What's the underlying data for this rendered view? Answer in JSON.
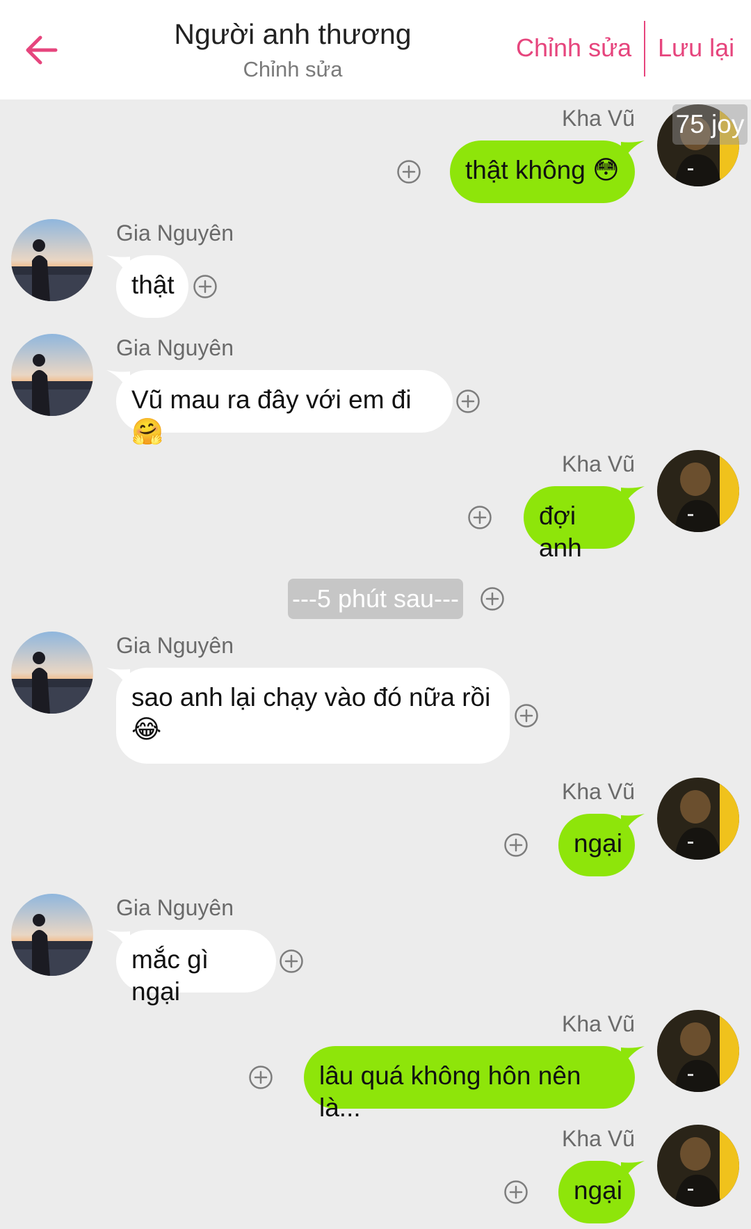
{
  "header": {
    "title": "Người anh thương",
    "subtitle": "Chỉnh sửa",
    "edit_label": "Chỉnh sửa",
    "save_label": "Lưu lại",
    "accent": "#e6457d"
  },
  "joy_badge": "75 joy",
  "colors": {
    "sent_bubble": "#8ee50a",
    "received_bubble": "#ffffff",
    "background": "#ececec"
  },
  "messages": [
    {
      "side": "right",
      "name": "Kha Vũ",
      "text": "thật không 😳"
    },
    {
      "side": "left",
      "name": "Gia Nguyên",
      "text": "thật"
    },
    {
      "side": "left",
      "name": "Gia Nguyên",
      "text": "Vũ mau ra đây với em đi 🤗"
    },
    {
      "side": "right",
      "name": "Kha Vũ",
      "text": "đợi anh"
    },
    {
      "side": "separator",
      "text": "---5 phút sau---"
    },
    {
      "side": "left",
      "name": "Gia Nguyên",
      "text": "sao anh lại chạy vào đó nữa rồi 😂"
    },
    {
      "side": "right",
      "name": "Kha Vũ",
      "text": "ngại"
    },
    {
      "side": "left",
      "name": "Gia Nguyên",
      "text": "mắc gì ngại"
    },
    {
      "side": "right",
      "name": "Kha Vũ",
      "text": "lâu quá không hôn nên là..."
    },
    {
      "side": "right",
      "name": "Kha Vũ",
      "text": "ngại"
    }
  ]
}
